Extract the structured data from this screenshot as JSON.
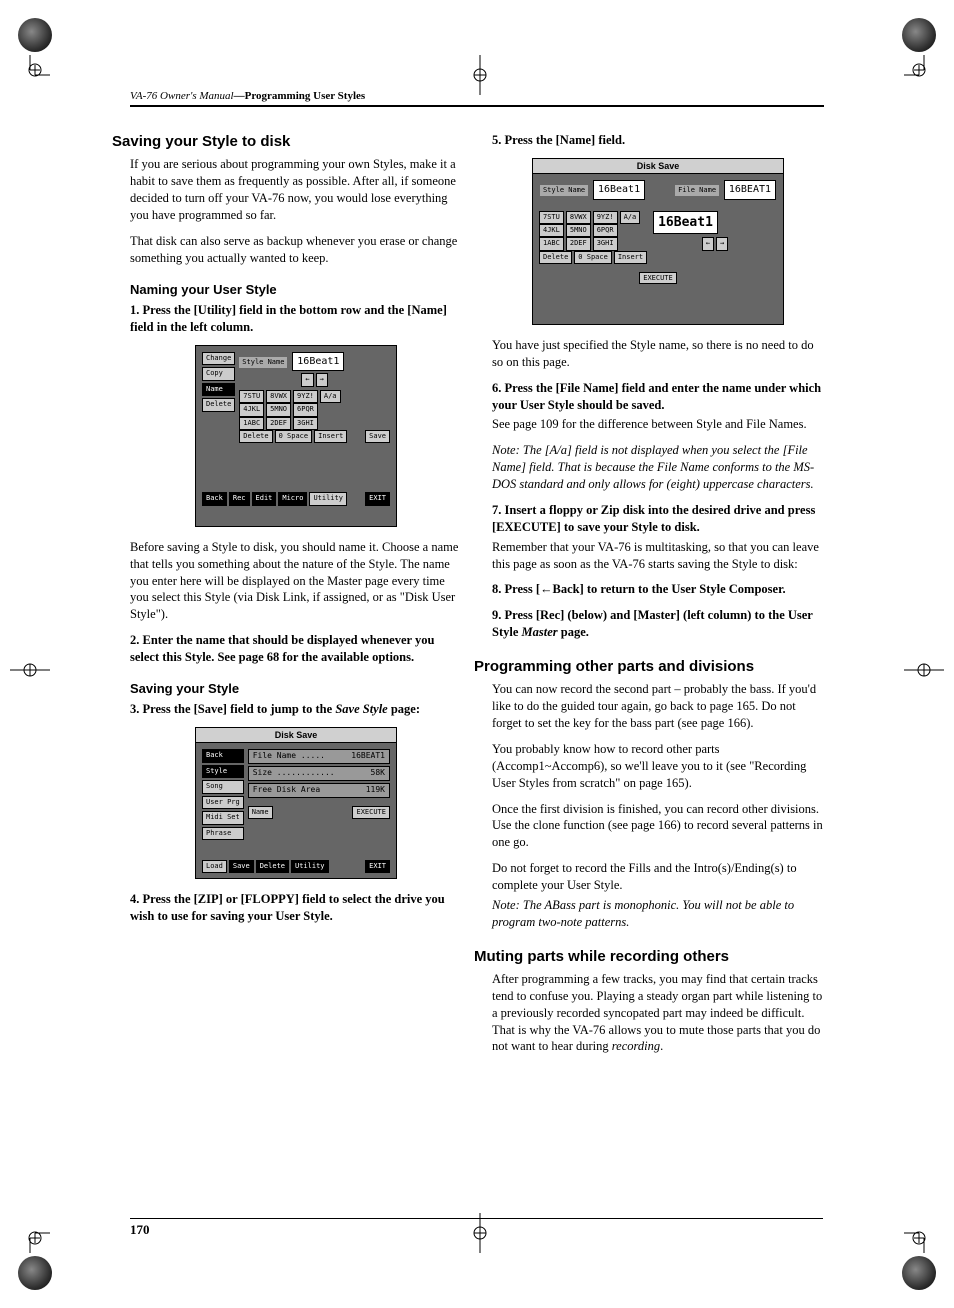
{
  "running_head": {
    "manual": "VA-76 Owner's Manual",
    "section": "—Programming User Styles"
  },
  "page_number": "170",
  "col1": {
    "h2_1": "Saving your Style to disk",
    "p1": "If you are serious about programming your own Styles, make it a habit to save them as frequently as possible. After all, if someone decided to turn off your VA-76 now, you would lose everything you have programmed so far.",
    "p2": "That disk can also serve as backup whenever you erase or change something you actually wanted to keep.",
    "h3_1": "Naming your User Style",
    "step1_num": "1.",
    "step1": "Press the [Utility] field in the bottom row and the [Name] field in the left column.",
    "p3": "Before saving a Style to disk, you should name it. Choose a name that tells you something about the nature of the Style. The name you enter here will be displayed on the Master page every time you select this Style (via Disk Link, if assigned, or as \"Disk User Style\").",
    "step2_num": "2.",
    "step2": "Enter the name that should be displayed whenever you select this Style. See page 68 for the available options.",
    "h3_2": "Saving your Style",
    "step3_num": "3.",
    "step3_a": "Press the [Save] field to jump to the ",
    "step3_i": "Save Style",
    "step3_b": " page:",
    "step4_num": "4.",
    "step4": "Press the [ZIP] or [FLOPPY] field to select the drive you wish to use for saving your User Style."
  },
  "col2": {
    "step5_num": "5.",
    "step5": "Press the [Name] field.",
    "p1": "You have just specified the Style name, so there is no need to do so on this page.",
    "step6_num": "6.",
    "step6": "Press the [File Name] field and enter the name under which your User Style should be saved.",
    "p2": "See page 109 for the difference between Style and File Names.",
    "note1": "Note: The [A/a] field is not displayed when you select the [File Name] field. That is because the File Name conforms to the MS-DOS standard and only allows for (eight) uppercase characters.",
    "step7_num": "7.",
    "step7": "Insert a floppy or Zip disk into the desired drive and press [EXECUTE] to save your Style to disk.",
    "p3": "Remember that your VA-76 is multitasking, so that you can leave this page as soon as the VA-76 starts saving the Style to disk:",
    "step8_num": "8.",
    "step8": "Press [←Back] to return to the User Style Composer.",
    "step9_num": "9.",
    "step9_a": "Press [Rec] (below) and [Master] (left column) to the User Style ",
    "step9_i": "Master",
    "step9_b": " page.",
    "h2_1": "Programming other parts and divisions",
    "p4": "You can now record the second part – probably the bass. If you'd like to do the guided tour again, go back to page 165. Do not forget to set the key for the bass part (see page 166).",
    "p5": "You probably know how to record other parts (Accomp1~Accomp6), so we'll leave you to it (see \"Recording User Styles from scratch\" on page 165).",
    "p6": "Once the first division is finished, you can record other divisions. Use the clone function (see page 166) to record several patterns in one go.",
    "p7": "Do not forget to record the Fills and the Intro(s)/Ending(s) to complete your User Style.",
    "note2": "Note: The ABass part is monophonic. You will not be able to program two-note patterns.",
    "h2_2": "Muting parts while recording others",
    "p8a": "After programming a few tracks, you may find that certain tracks tend to confuse you. Playing a steady organ part while listening to a previously recorded syncopated part may indeed be difficult. That is why the VA-76 allows you to mute those parts that you do not want to hear during ",
    "p8i": "recording",
    "p8b": "."
  },
  "screenshot1": {
    "title": "Style Name",
    "value": "16Beat1",
    "side_buttons": [
      "Change",
      "Copy",
      "Name",
      "Delete"
    ],
    "keypad": [
      "7STU",
      "8VWX",
      "9YZ!",
      "4JKL",
      "5MNO",
      "6PQR",
      "1ABC",
      "2DEF",
      "3GHI",
      "Delete",
      "0 Space",
      "Insert"
    ],
    "aa": "A/a",
    "arrows": [
      "←",
      "→"
    ],
    "save": "Save",
    "bottom": [
      "Back",
      "Rec",
      "Edit",
      "Micro",
      "Utility",
      "EXIT"
    ]
  },
  "screenshot2": {
    "title": "Disk Save",
    "side_buttons": [
      "Style",
      "Song",
      "User Prg",
      "Midi Set",
      "Phrase"
    ],
    "rows": [
      {
        "k": "File Name .....",
        "v": "16BEAT1"
      },
      {
        "k": "Size ............",
        "v": "58K"
      },
      {
        "k": "Free Disk Area",
        "v": "119K"
      }
    ],
    "name": "Name",
    "execute": "EXECUTE",
    "back": "Back",
    "bottom": [
      "Load",
      "Save",
      "Delete",
      "Utility",
      "EXIT"
    ]
  },
  "screenshot3": {
    "title": "Disk Save",
    "style_name_label": "Style Name",
    "style_name_value": "16Beat1",
    "file_name_label": "File Name",
    "file_name_value": "16BEAT1",
    "big_value": "16Beat1",
    "keypad": [
      "7STU",
      "8VWX",
      "9YZ!",
      "4JKL",
      "5MNO",
      "6PQR",
      "1ABC",
      "2DEF",
      "3GHI",
      "Delete",
      "0 Space",
      "Insert"
    ],
    "aa": "A/a",
    "arrows": [
      "←",
      "→"
    ],
    "execute": "EXECUTE"
  }
}
